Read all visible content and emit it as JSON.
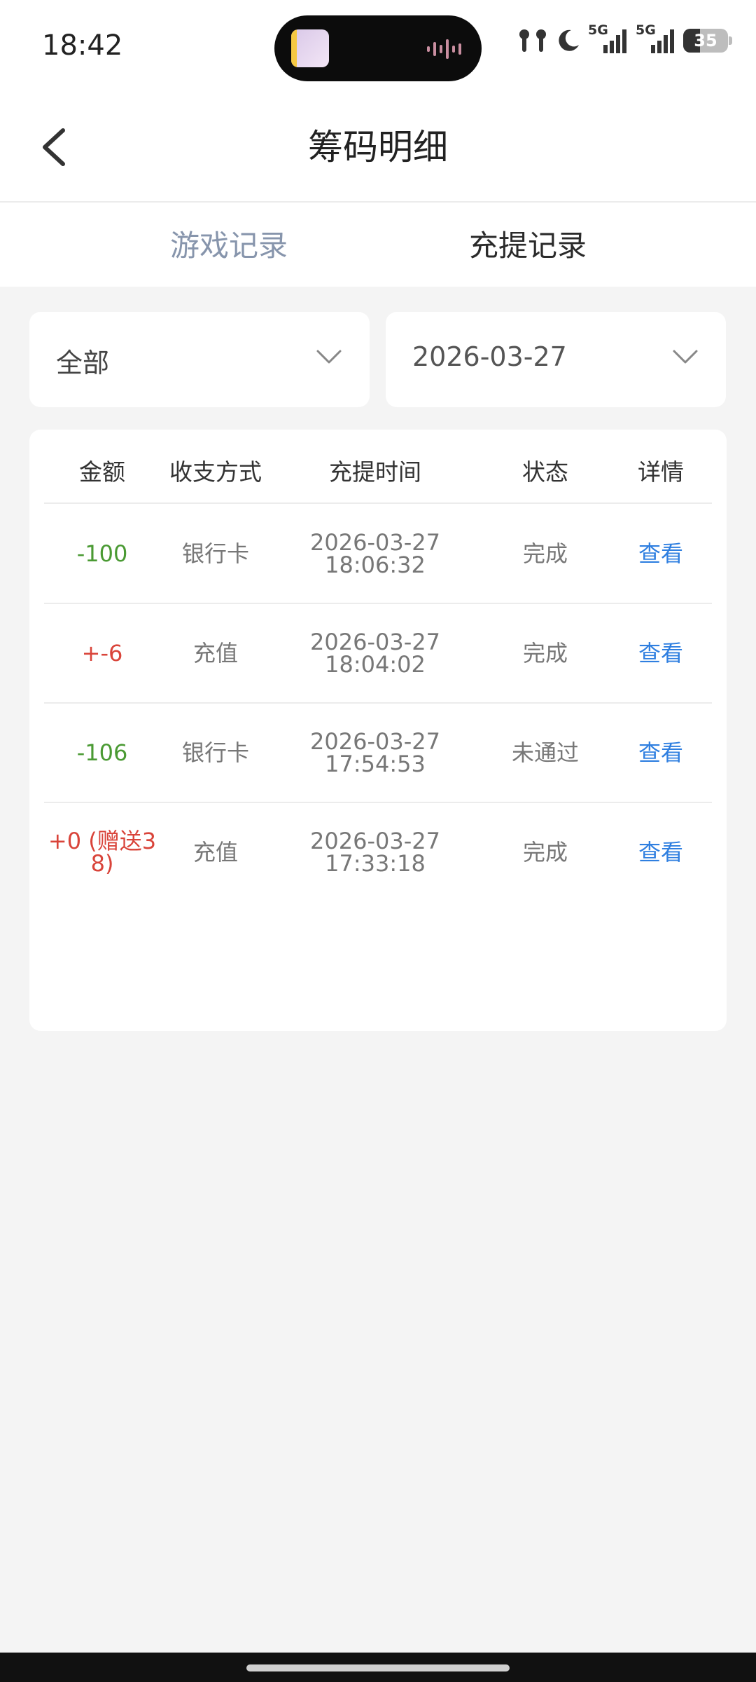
{
  "status": {
    "time": "18:42",
    "battery": "35",
    "net1": "5G",
    "net2": "5G"
  },
  "header": {
    "title": "筹码明细"
  },
  "tabs": [
    {
      "label": "游戏记录",
      "active": false
    },
    {
      "label": "充提记录",
      "active": true
    }
  ],
  "filters": {
    "type": "全部",
    "date": "2026-03-27"
  },
  "table": {
    "columns": [
      "金额",
      "收支方式",
      "充提时间",
      "状态",
      "详情"
    ],
    "rows": [
      {
        "amount": "-100",
        "method": "银行卡",
        "date": "2026-03-27",
        "time": "18:06:32",
        "status": "完成",
        "action": "查看"
      },
      {
        "amount": "+-6",
        "method": "充值",
        "date": "2026-03-27",
        "time": "18:04:02",
        "status": "完成",
        "action": "查看"
      },
      {
        "amount": "-106",
        "method": "银行卡",
        "date": "2026-03-27",
        "time": "17:54:53",
        "status": "未通过",
        "action": "查看"
      },
      {
        "amount_line1": "+0 (赠送3",
        "amount_line2": "8)",
        "method": "充值",
        "date": "2026-03-27",
        "time": "17:33:18",
        "status": "完成",
        "action": "查看"
      }
    ]
  },
  "colors": {
    "negative": "#4a9a33",
    "positive": "#d9443a",
    "link": "#2f7fe0",
    "inactive_tab": "#8795ac"
  }
}
